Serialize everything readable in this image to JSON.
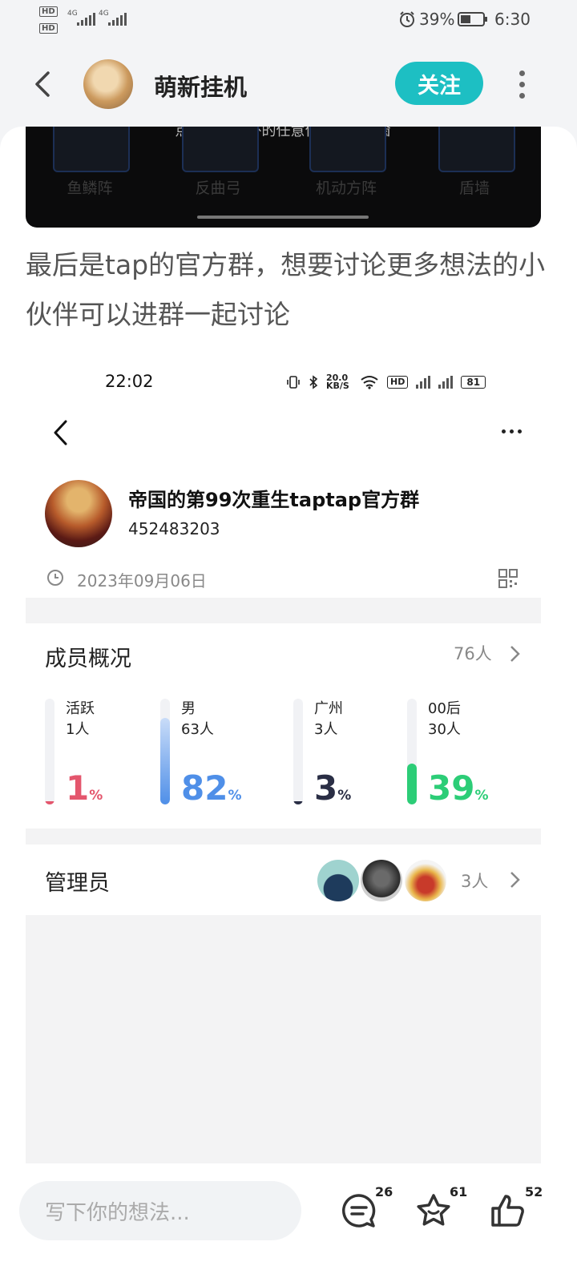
{
  "status_bar": {
    "signal1": "4G",
    "signal2": "4G",
    "battery": "39%",
    "time": "6:30",
    "hd_label": "HD"
  },
  "header": {
    "author": "萌新挂机",
    "follow": "关注"
  },
  "video": {
    "hint": "点击弹窗以外的任意位置关闭弹窗",
    "labels": [
      "鱼鳞阵",
      "反曲弓",
      "机动方阵",
      "盾墙"
    ]
  },
  "post": {
    "paragraph": "最后是tap的官方群，想要讨论更多想法的小伙伴可以进群一起讨论"
  },
  "shot": {
    "time": "22:02",
    "net_speed": "20.0 KB/S",
    "battery": "81",
    "group_name": "帝国的第99次重生taptap官方群",
    "group_id": "452483203",
    "date": "2023年09月06日",
    "members_title": "成员概况",
    "members_count": "76人",
    "stats": [
      {
        "label": "活跃",
        "count": "1人",
        "value": "1",
        "unit": "%",
        "fraction": 0.01,
        "color": "#e4566d"
      },
      {
        "label": "男",
        "count": "63人",
        "value": "82",
        "unit": "%",
        "fraction": 0.82,
        "color": "#4f8fe8"
      },
      {
        "label": "广州",
        "count": "3人",
        "value": "3",
        "unit": "%",
        "fraction": 0.03,
        "color": "#2a2e45"
      },
      {
        "label": "00后",
        "count": "30人",
        "value": "39",
        "unit": "%",
        "fraction": 0.39,
        "color": "#2ccd77"
      }
    ],
    "admins_title": "管理员",
    "admins_count": "3人"
  },
  "bottom": {
    "placeholder": "写下你的想法...",
    "comments": "26",
    "favorites": "61",
    "likes": "52"
  },
  "colors": {
    "accent": "#1dbfc3"
  }
}
